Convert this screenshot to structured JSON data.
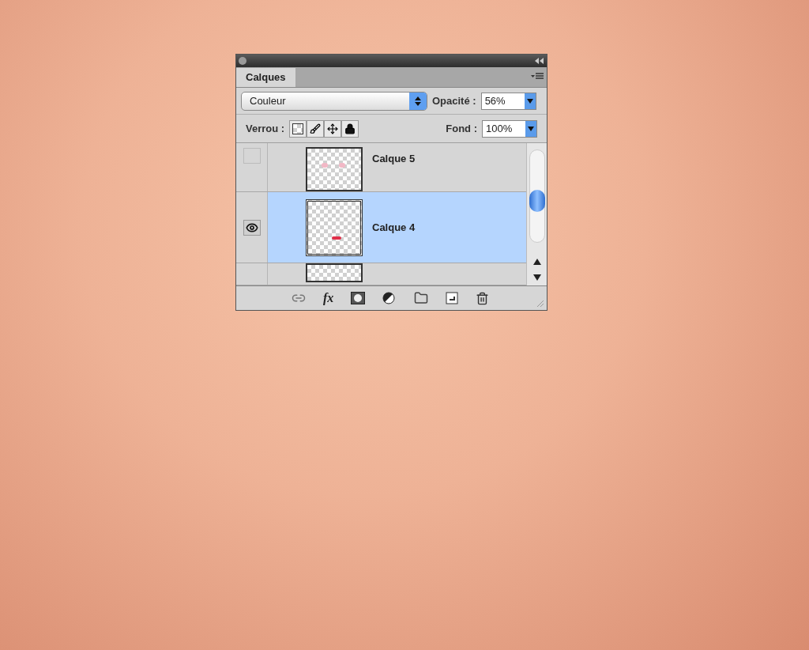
{
  "panel": {
    "tab": "Calques",
    "blend_mode": "Couleur",
    "opacity_label": "Opacité :",
    "opacity": "56%",
    "lock_label": "Verrou :",
    "fill_label": "Fond :",
    "fill": "100%",
    "effects_label": "fx",
    "layers": [
      {
        "name": "Calque 5",
        "visible": false,
        "selected": false,
        "kind": "top"
      },
      {
        "name": "Calque 4",
        "visible": true,
        "selected": true,
        "kind": "full"
      },
      {
        "kind": "bottom",
        "selected": false
      }
    ]
  }
}
